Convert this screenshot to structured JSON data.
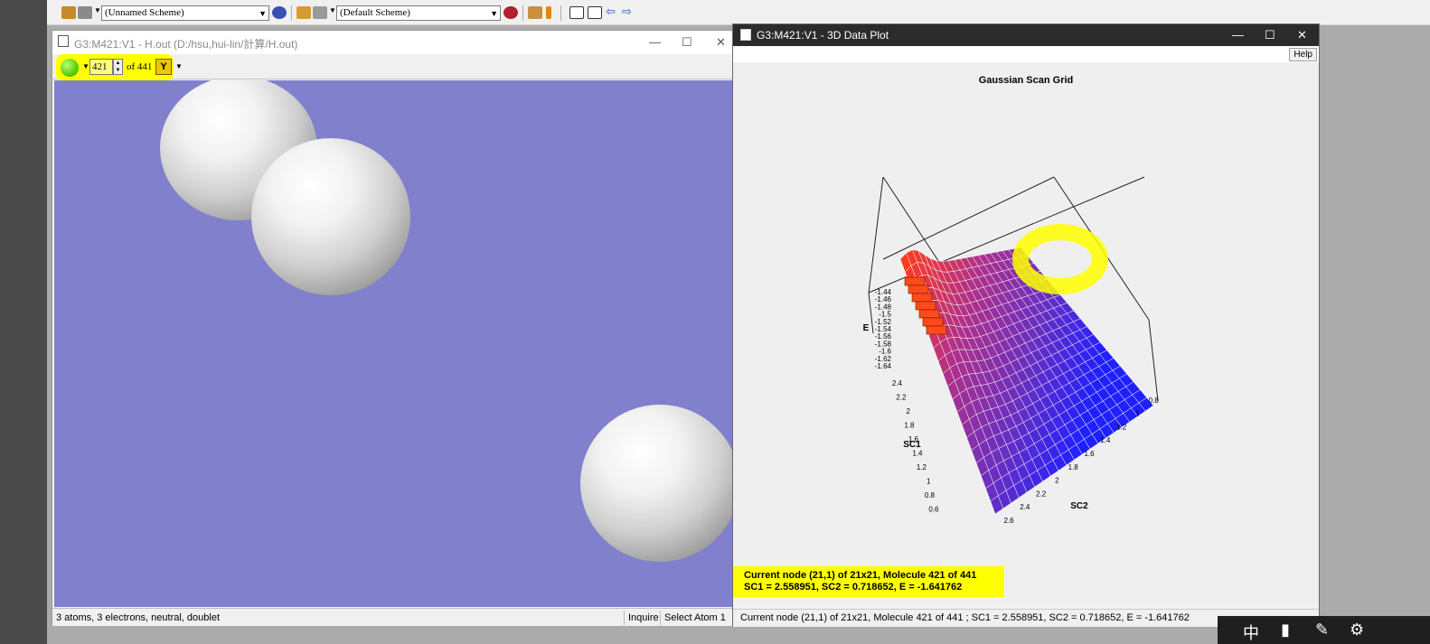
{
  "toolbar": {
    "scheme1": "(Unnamed Scheme)",
    "scheme2": "(Default Scheme)"
  },
  "mol_window": {
    "title": "G3:M421:V1 - H.out (D:/hsu,hui-lin/計算/H.out)",
    "frame_current": "421",
    "frame_of": "of 441",
    "status_text": "3 atoms, 3 electrons, neutral, doublet",
    "status_inquire": "Inquire",
    "status_select": "Select Atom 1",
    "viewport_bg": "#8080cc"
  },
  "plot_window": {
    "title": "G3:M421:V1 - 3D Data Plot",
    "help_label": "Help",
    "node_line1": "Current node (21,1) of 21x21, Molecule 421 of 441",
    "node_line2": "SC1 = 2.558951, SC2 = 0.718652, E = -1.641762",
    "status_text": "Current node (21,1) of 21x21, Molecule 421 of 441 ; SC1 = 2.558951, SC2 = 0.718652, E = -1.641762"
  },
  "chart_data": {
    "type": "surface",
    "title": "Gaussian Scan Grid",
    "zlabel": "E",
    "xlabel": "SC1",
    "ylabel": "SC2",
    "z_ticks": [
      "-1.44",
      "-1.46",
      "-1.48",
      "-1.5",
      "-1.52",
      "-1.54",
      "-1.56",
      "-1.58",
      "-1.6",
      "-1.62",
      "-1.64"
    ],
    "sc1_ticks": [
      "2.4",
      "2.2",
      "2",
      "1.8",
      "1.6",
      "1.4",
      "1.2",
      "1",
      "0.8",
      "0.6"
    ],
    "sc2_ticks": [
      "2.6",
      "2.4",
      "2.2",
      "2",
      "1.8",
      "1.6",
      "1.4",
      "1.2",
      "1",
      "0.8"
    ],
    "grid_size": [
      21,
      21
    ],
    "current_node": {
      "i": 21,
      "j": 1,
      "SC1": 2.558951,
      "SC2": 0.718652,
      "E": -1.641762
    },
    "colormap": [
      "#ff3b1f",
      "#b0308a",
      "#6a2fc0",
      "#2020ff"
    ]
  },
  "taskbar": {
    "ime": "中"
  }
}
